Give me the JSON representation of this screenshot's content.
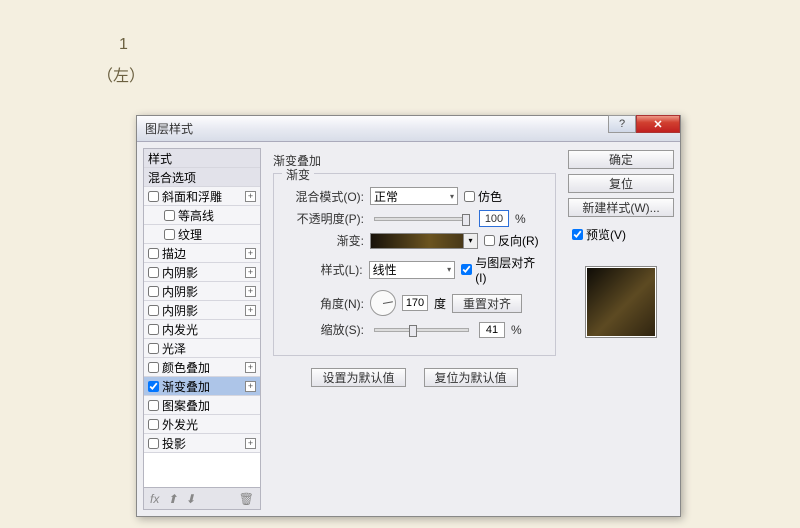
{
  "page": {
    "num": "1",
    "label": "（左）"
  },
  "dialog": {
    "title": "图层样式"
  },
  "sidebar": {
    "header": "样式",
    "blend": "混合选项",
    "items": [
      {
        "label": "斜面和浮雕",
        "checked": false,
        "plus": true
      },
      {
        "label": "等高线",
        "checked": false,
        "sub": true
      },
      {
        "label": "纹理",
        "checked": false,
        "sub": true
      },
      {
        "label": "描边",
        "checked": false,
        "plus": true
      },
      {
        "label": "内阴影",
        "checked": false,
        "plus": true
      },
      {
        "label": "内阴影",
        "checked": false,
        "plus": true
      },
      {
        "label": "内阴影",
        "checked": false,
        "plus": true
      },
      {
        "label": "内发光",
        "checked": false
      },
      {
        "label": "光泽",
        "checked": false
      },
      {
        "label": "颜色叠加",
        "checked": false,
        "plus": true
      },
      {
        "label": "渐变叠加",
        "checked": true,
        "plus": true,
        "selected": true
      },
      {
        "label": "图案叠加",
        "checked": false
      },
      {
        "label": "外发光",
        "checked": false
      },
      {
        "label": "投影",
        "checked": false,
        "plus": true
      }
    ],
    "footer": {
      "fx": "fx",
      "trash": "🗑"
    }
  },
  "panel": {
    "title": "渐变叠加",
    "legend": "渐变",
    "blendMode": {
      "label": "混合模式(O):",
      "value": "正常",
      "dither": "仿色"
    },
    "opacity": {
      "label": "不透明度(P):",
      "value": "100",
      "unit": "%"
    },
    "gradient": {
      "label": "渐变:",
      "reverse": "反向(R)"
    },
    "style": {
      "label": "样式(L):",
      "value": "线性",
      "align": "与图层对齐(I)"
    },
    "angle": {
      "label": "角度(N):",
      "value": "170",
      "unit": "度",
      "reset": "重置对齐"
    },
    "scale": {
      "label": "缩放(S):",
      "value": "41",
      "unit": "%"
    },
    "setDefault": "设置为默认值",
    "resetDefault": "复位为默认值"
  },
  "buttons": {
    "ok": "确定",
    "cancel": "复位",
    "newStyle": "新建样式(W)...",
    "preview": "预览(V)"
  }
}
